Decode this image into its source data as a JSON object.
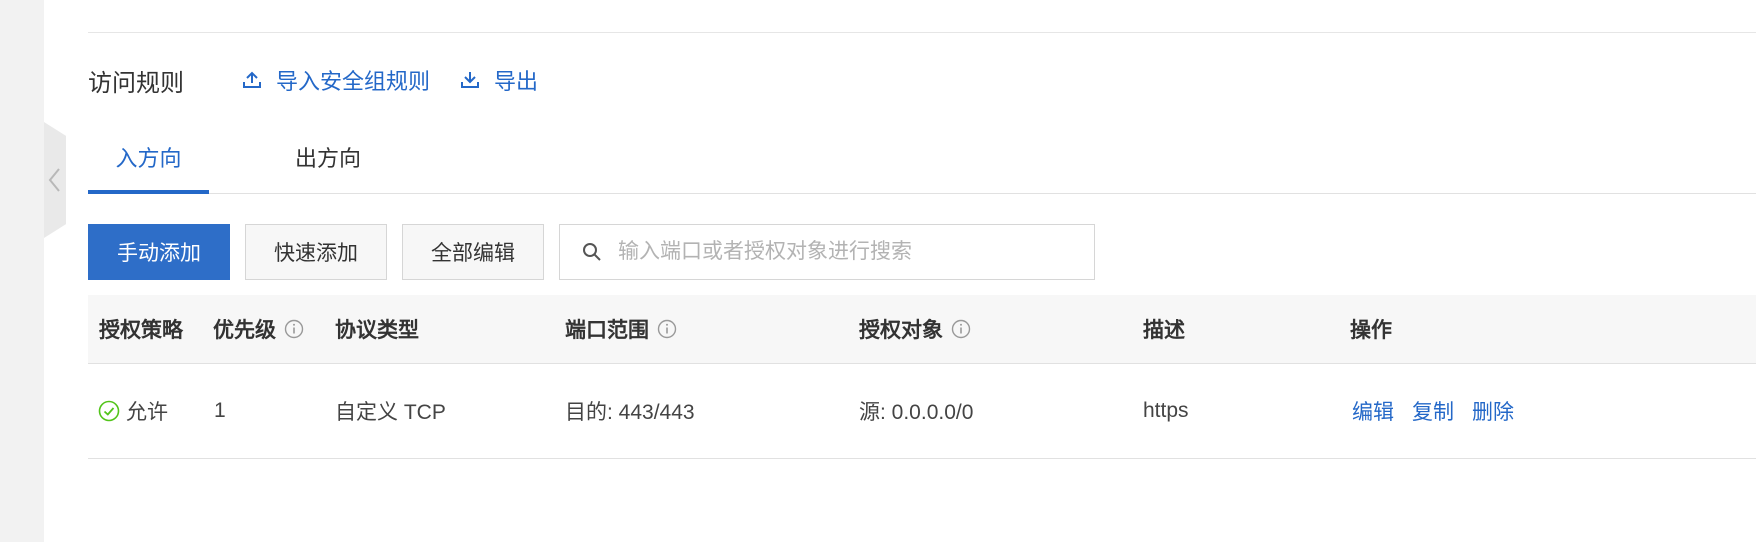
{
  "section": {
    "title": "访问规则",
    "import_label": "导入安全组规则",
    "export_label": "导出"
  },
  "tabs": [
    {
      "label": "入方向",
      "active": true
    },
    {
      "label": "出方向",
      "active": false
    }
  ],
  "toolbar": {
    "manual_add": "手动添加",
    "quick_add": "快速添加",
    "edit_all": "全部编辑",
    "search_placeholder": "输入端口或者授权对象进行搜索"
  },
  "table": {
    "columns": [
      "授权策略",
      "优先级",
      "协议类型",
      "端口范围",
      "授权对象",
      "描述",
      "操作"
    ],
    "rows": [
      {
        "policy": "允许",
        "priority": "1",
        "protocol": "自定义 TCP",
        "port": "目的: 443/443",
        "target": "源: 0.0.0.0/0",
        "desc": "https",
        "actions": [
          "编辑",
          "复制",
          "删除"
        ]
      }
    ]
  },
  "colors": {
    "accent": "#2468c8",
    "primary_button": "#2e6ec8",
    "allow_green": "#52c41a"
  },
  "icons": {
    "import": "upload-icon",
    "export": "download-icon",
    "search": "search-icon",
    "info": "info-circle-icon",
    "allow": "check-circle-icon",
    "collapse": "chevron-left-icon"
  }
}
